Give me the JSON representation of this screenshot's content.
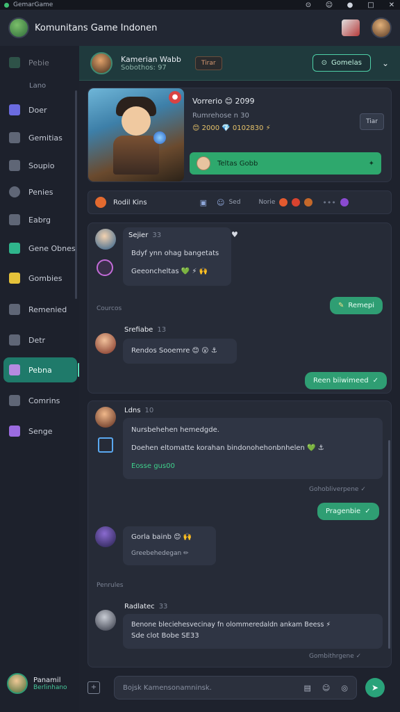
{
  "window": {
    "title": "GemarGame"
  },
  "header": {
    "brand": "Komunitans Game Indonen"
  },
  "sidebar": {
    "items": [
      {
        "label": "Pebie",
        "color": "#3d7a5f"
      },
      {
        "label": "Doer",
        "color": "#6b6be0"
      },
      {
        "label": "Gemitias",
        "color": "#8a92a3"
      },
      {
        "label": "Soupio",
        "color": "#8a92a3"
      },
      {
        "label": "Penies",
        "color": "#8a92a3"
      },
      {
        "label": "Eabrg",
        "color": "#8a92a3"
      },
      {
        "label": "Gene Obnes",
        "color": "#2fb58c"
      },
      {
        "label": "Gombies",
        "color": "#e5c23a"
      },
      {
        "label": "Remenied",
        "color": "#8a92a3"
      },
      {
        "label": "Detr",
        "color": "#8a92a3"
      },
      {
        "label": "Pebna",
        "color": "#b58ae0"
      },
      {
        "label": "Comrins",
        "color": "#8a92a3"
      },
      {
        "label": "Senge",
        "color": "#9b6be0"
      }
    ],
    "section_label": "Lano"
  },
  "profile": {
    "name": "Panamil",
    "status": "Berlinhano"
  },
  "channel": {
    "name": "Kamerian Wabb",
    "sub": "Sobothos: 97",
    "tag": "Tirar",
    "join_label": "Gomelas"
  },
  "hero": {
    "title": "Vorrerio 😊 2099",
    "sub": "Rumrehose n 30",
    "stat": "😊 2000 💎 0102830 ⚡",
    "small_btn": "Tiar",
    "action_label": "Teltas Gobb",
    "badge": "●"
  },
  "filter": {
    "label": "Rodil Kins",
    "icon_text": "Sed",
    "tag_text": "Norie"
  },
  "chat1": {
    "m1": {
      "name": "Sejier",
      "meta": "33",
      "line1": "Bdyf ynn ohag bangetats",
      "line2": "Geeoncheltas 💚 ⚡ 🙌"
    },
    "section": "Courcos",
    "out1": "Remepi",
    "m2": {
      "name": "Srefiabe",
      "meta": "13",
      "line1": "Rendos Sooemre 😊 😮 ⚓"
    },
    "out2": "Reen biiwimeed"
  },
  "chat2": {
    "m1": {
      "name": "Ldns",
      "meta": "10",
      "line1": "Nursbehehen hemedgde.",
      "line2": "Doehen eltomatte korahan bindonohehonbnhelen 💚 ⚓",
      "line3": "Eosse gus00"
    },
    "receipt1": "Gohobliverpene",
    "out1": "Pragenbie",
    "m2": {
      "name": "",
      "line1": "Gorla bainb 😊 🙌",
      "line2": "Greebehedegan ✏"
    },
    "section": "Penrules",
    "m3": {
      "name": "Radlatec",
      "meta": "33",
      "line1": "Benone bleciehesvecinay fn olommeredaldn ankam Beess ⚡",
      "line2": "Sde clot Bobe SE33"
    },
    "receipt2": "Gombithrgene"
  },
  "composer": {
    "placeholder": "Bojsk Kamensonamninsk."
  }
}
